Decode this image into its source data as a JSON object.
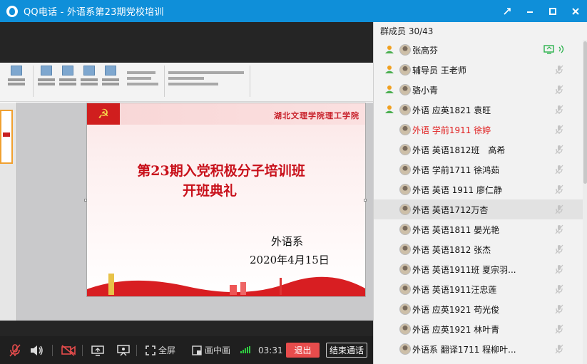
{
  "window": {
    "title": "QQ电话 - 外语系第23期党校培训",
    "controls": [
      "pin-icon",
      "minimize-icon",
      "maximize-icon",
      "close-icon"
    ]
  },
  "slide": {
    "college": "湖北文理学院理工学院",
    "title_line1": "第23期入党积极分子培训班",
    "title_line2": "开班典礼",
    "department": "外语系",
    "date": "2020年4月15日",
    "accent_color": "#c8101a"
  },
  "toolbar": {
    "fullscreen_label": "全屏",
    "pip_label": "画中画",
    "duration": "03:31",
    "exit_label": "退出",
    "end_call_label": "结束通话"
  },
  "panel": {
    "header": "群成员 30/43",
    "members": [
      {
        "name": "张高芬",
        "role": "admin",
        "status": "screen-share"
      },
      {
        "name": "辅导员 王老师",
        "role": "admin",
        "status": "mic-off"
      },
      {
        "name": "骆小青",
        "role": "admin",
        "status": "mic-off"
      },
      {
        "name": "外语 应英1821 袁旺",
        "role": "admin",
        "status": "mic-off"
      },
      {
        "name": "外语 学前1911 徐婷",
        "role": "member",
        "status": "mic-off",
        "highlight_color": "#e02020"
      },
      {
        "name": "外语 英语1812班　高希",
        "role": "member",
        "status": "mic-off"
      },
      {
        "name": "外语 学前1711 徐鸿茹",
        "role": "member",
        "status": "mic-off"
      },
      {
        "name": "外语 英语 1911 廖仁静",
        "role": "member",
        "status": "mic-off"
      },
      {
        "name": "外语 英语1712万杏",
        "role": "member",
        "status": "mic-off",
        "selected": true
      },
      {
        "name": "外语 英语1811 晏光艳",
        "role": "member",
        "status": "mic-off"
      },
      {
        "name": "外语 英语1812 张杰",
        "role": "member",
        "status": "mic-off"
      },
      {
        "name": "外语 英语1911班 夏宗羽...",
        "role": "member",
        "status": "mic-off"
      },
      {
        "name": "外语 英语1911汪忠莲",
        "role": "member",
        "status": "mic-off"
      },
      {
        "name": "外语 应英1921 苟光俊",
        "role": "member",
        "status": "mic-off"
      },
      {
        "name": "外语 应英1921 林叶青",
        "role": "member",
        "status": "mic-off"
      },
      {
        "name": "外语系 翻译1711 程柳叶...",
        "role": "member",
        "status": "mic-off"
      }
    ]
  }
}
